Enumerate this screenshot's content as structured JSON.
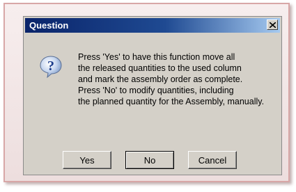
{
  "dialog": {
    "title": "Question",
    "icon": "question-icon",
    "message_lines": [
      "Press 'Yes' to have this function move all",
      "the released quantities to the used column",
      "and mark the assembly order as complete.",
      "Press 'No' to modify quantities, including",
      "the planned quantity for the Assembly, manually."
    ],
    "buttons": {
      "yes": "Yes",
      "no": "No",
      "cancel": "Cancel"
    }
  },
  "colors": {
    "title_bar": "#0a246a",
    "dialog_bg": "#d4d0c8",
    "frame_border": "#d8a7a7"
  }
}
